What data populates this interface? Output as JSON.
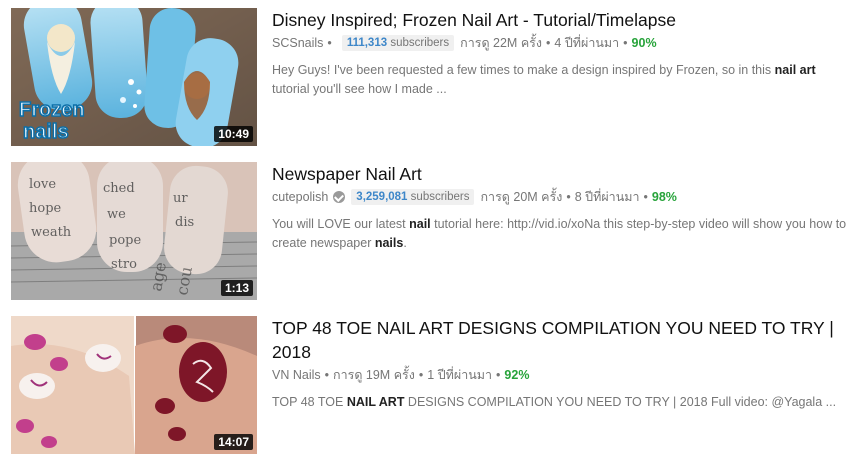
{
  "videos": [
    {
      "title": "Disney Inspired; Frozen Nail Art - Tutorial/Timelapse",
      "channel": "SCSnails",
      "subs_count": "111,313",
      "subs_label": "subscribers",
      "views": "การดู 22M ครั้ง",
      "age": "4 ปีที่ผ่านมา",
      "rating": "90%",
      "duration": "10:49",
      "thumb_text": "Frozen nails",
      "desc_a": "Hey Guys! I've been requested a few times to make a design inspired by Frozen, so in this ",
      "desc_b": "nail art",
      "desc_c": " tutorial you'll see how I made ..."
    },
    {
      "title": "Newspaper Nail Art",
      "channel": "cutepolish",
      "subs_count": "3,259,081",
      "subs_label": "subscribers",
      "views": "การดู 20M ครั้ง",
      "age": "8 ปีที่ผ่านมา",
      "rating": "98%",
      "duration": "1:13",
      "desc_a": "You will LOVE our latest ",
      "desc_b": "nail",
      "desc_c": " tutorial here: http://vid.io/xoNa this step-by-step video will show you how to create newspaper ",
      "desc_d": "nails",
      "desc_e": "."
    },
    {
      "title": "TOP 48 TOE NAIL ART DESIGNS COMPILATION YOU NEED TO TRY | 2018",
      "channel": "VN Nails",
      "views": "การดู 19M ครั้ง",
      "age": "1 ปีที่ผ่านมา",
      "rating": "92%",
      "duration": "14:07",
      "desc_a": "TOP 48 TOE ",
      "desc_b": "NAIL ART",
      "desc_c": " DESIGNS COMPILATION YOU NEED TO TRY | 2018 Full video: @Yagala ..."
    }
  ],
  "dot": "•"
}
